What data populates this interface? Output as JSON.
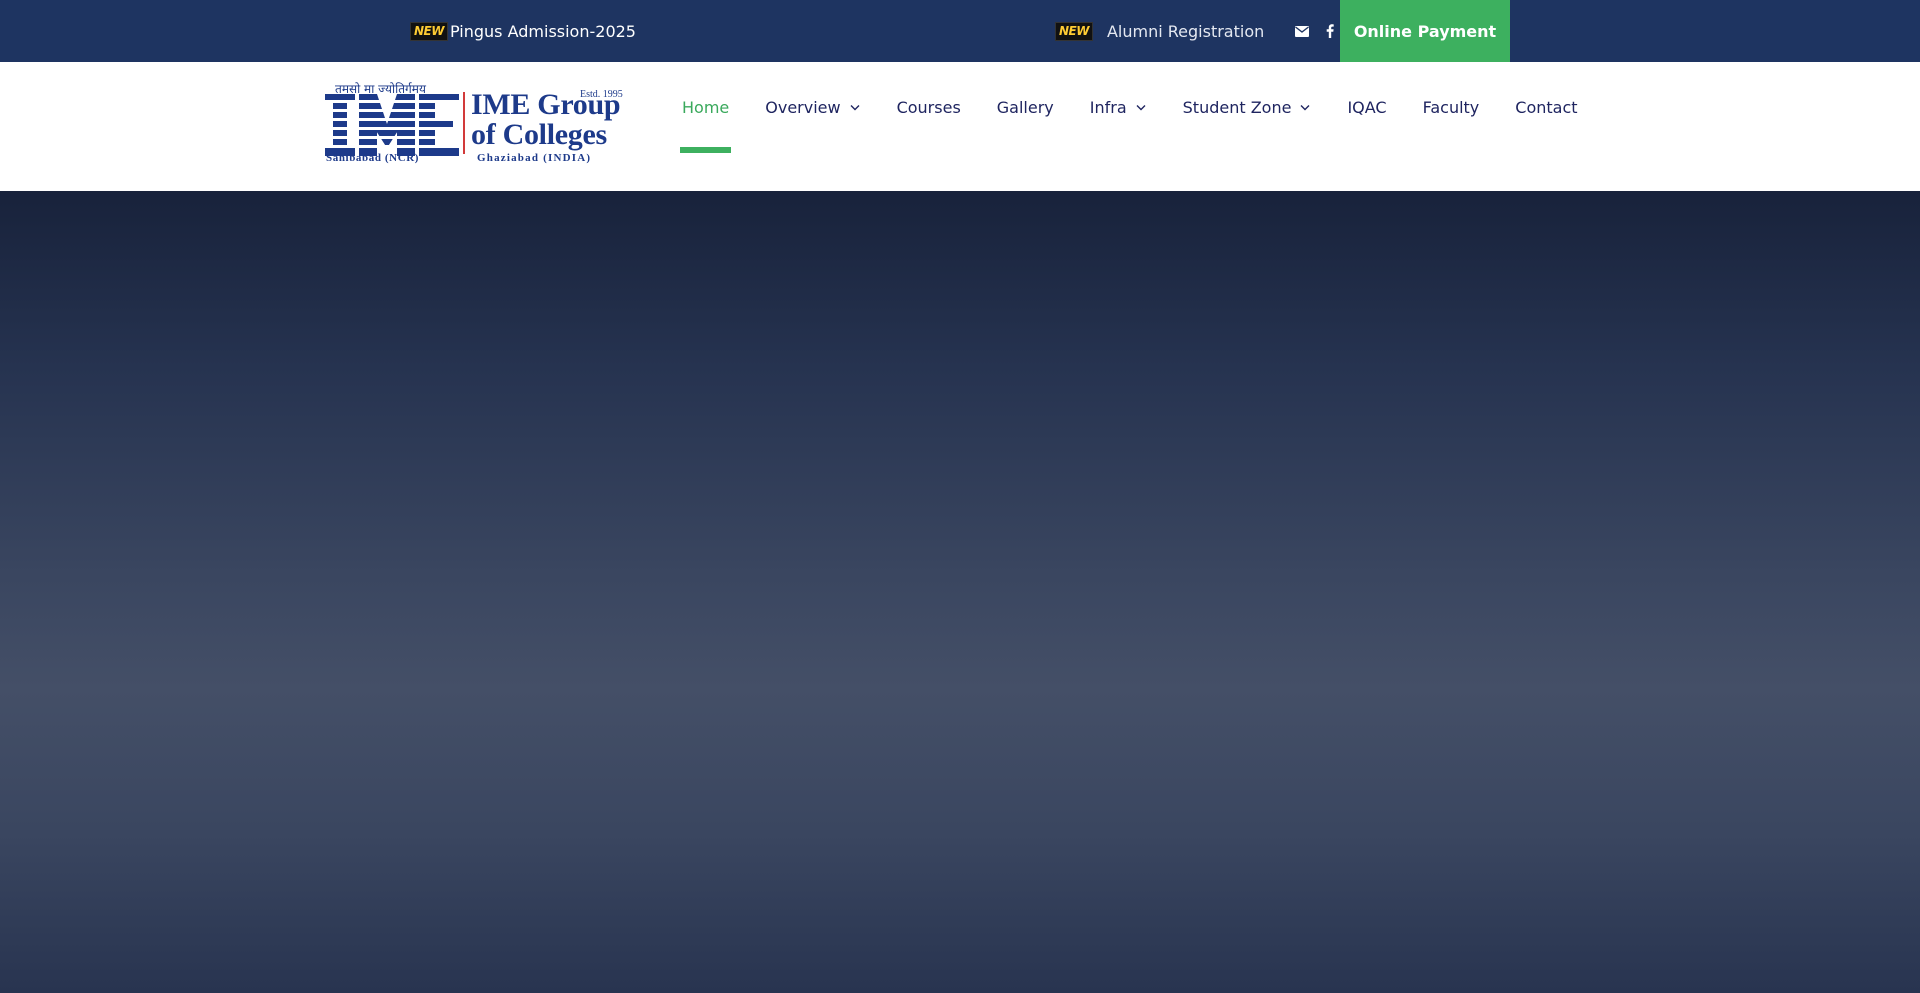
{
  "topbar": {
    "admission": {
      "badge": "NEW",
      "label": "Pingus Admission-2025"
    },
    "alumni": {
      "badge": "NEW",
      "label": "Alumni Registration"
    },
    "icons": [
      "envelope-icon",
      "facebook-icon"
    ],
    "online_payment_label": "Online Payment",
    "bg_color": "#1e3461",
    "accent_color": "#3db05f"
  },
  "logo": {
    "hindi_tagline": "तमसो मा ज्योतिर्गमय",
    "mark": "IME",
    "estd": "Estd. 1995",
    "title_line1": "IME Group",
    "title_line2": "of Colleges",
    "sub_left": "Sahibabad (NCR)",
    "sub_right": "Ghaziabad (INDIA)",
    "color": "#1d3a8a"
  },
  "nav": {
    "items": [
      {
        "label": "Home",
        "active": true,
        "dropdown": false
      },
      {
        "label": "Overview",
        "active": false,
        "dropdown": true
      },
      {
        "label": "Courses",
        "active": false,
        "dropdown": false
      },
      {
        "label": "Gallery",
        "active": false,
        "dropdown": false
      },
      {
        "label": "Infra",
        "active": false,
        "dropdown": true
      },
      {
        "label": "Student Zone",
        "active": false,
        "dropdown": true
      },
      {
        "label": "IQAC",
        "active": false,
        "dropdown": false
      },
      {
        "label": "Faculty",
        "active": false,
        "dropdown": false
      },
      {
        "label": "Contact",
        "active": false,
        "dropdown": false
      }
    ],
    "text_color": "#1f2560",
    "active_color": "#3aa95c"
  }
}
